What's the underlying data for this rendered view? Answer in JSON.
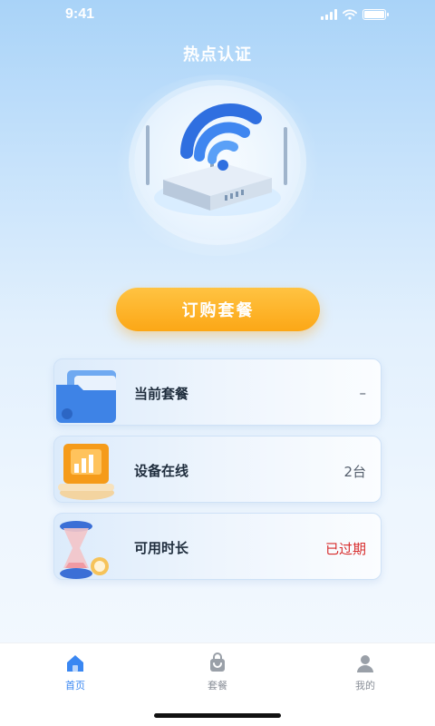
{
  "status_bar": {
    "time": "9:41"
  },
  "header": {
    "title": "热点认证"
  },
  "hero": {
    "illustration": "wifi-router-icon"
  },
  "order_button": {
    "label": "订购套餐"
  },
  "cards": [
    {
      "label": "当前套餐",
      "value": "–",
      "icon": "folder-icon"
    },
    {
      "label": "设备在线",
      "value": "2台",
      "icon": "device-chart-icon"
    },
    {
      "label": "可用时长",
      "value": "已过期",
      "icon": "hourglass-icon",
      "value_color": "#d72c2c"
    }
  ],
  "bottom_nav": {
    "items": [
      {
        "label": "首页",
        "icon": "home-icon",
        "active": true
      },
      {
        "label": "套餐",
        "icon": "bag-icon",
        "active": false
      },
      {
        "label": "我的",
        "icon": "user-icon",
        "active": false
      }
    ]
  },
  "colors": {
    "accent": "#3a87f2",
    "button": "#fcb124",
    "expired": "#d72c2c"
  }
}
